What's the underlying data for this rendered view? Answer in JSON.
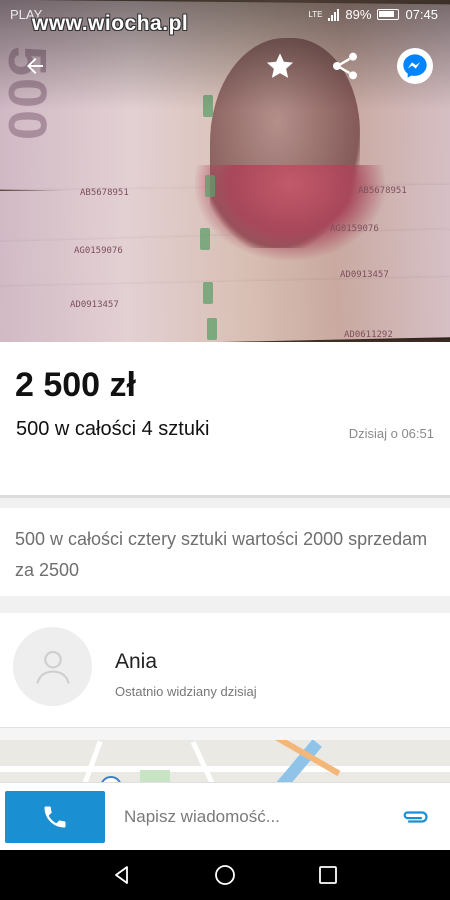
{
  "status_bar": {
    "carrier": "PLAY",
    "network": "LTE",
    "battery": "89%",
    "time": "07:45"
  },
  "watermark": "www.wiocha.pl",
  "hero": {
    "banknote_denomination": "500",
    "serials": [
      "AB5678951",
      "AB5678951",
      "AG0159076",
      "AG0159076",
      "AD0913457",
      "AD0913457",
      "AD0611292"
    ]
  },
  "listing": {
    "price": "2 500 zł",
    "title": "500 w całości 4 sztuki",
    "date": "Dzisiaj o 06:51",
    "description": "500 w całości cztery sztuki wartości 2000 sprzedam za 2500"
  },
  "seller": {
    "name": "Ania",
    "last_seen": "Ostatnio widziany dzisiaj"
  },
  "message_bar": {
    "placeholder": "Napisz wiadomość..."
  },
  "icons": {
    "back": "back-arrow-icon",
    "favorite": "star-icon",
    "share": "share-icon",
    "messenger": "messenger-icon",
    "phone": "phone-icon",
    "attach": "paperclip-icon"
  },
  "colors": {
    "accent": "#1a8fd2",
    "messenger": "#0084ff",
    "price_text": "#111111",
    "muted_text": "#6f6f6f"
  }
}
